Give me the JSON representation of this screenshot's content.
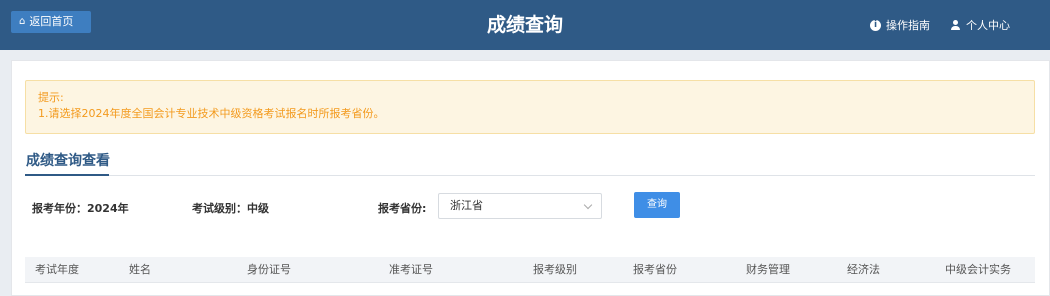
{
  "header": {
    "home_label": "返回首页",
    "title": "成绩查询",
    "guide_label": "操作指南",
    "user_label": "个人中心"
  },
  "notice": {
    "title": "提示:",
    "line1": "1.请选择2024年度全国会计专业技术中级资格考试报名时所报考省份。"
  },
  "section": {
    "title": "成绩查询查看"
  },
  "form": {
    "year_label": "报考年份：2024年",
    "level_label": "考试级别：中级",
    "province_label": "报考省份:",
    "province_value": "浙江省",
    "query_label": "查询"
  },
  "table": {
    "columns": [
      "考试年度",
      "姓名",
      "身份证号",
      "准考证号",
      "报考级别",
      "报考省份",
      "财务管理",
      "经济法",
      "中级会计实务"
    ]
  },
  "colors": {
    "header_bg": "#2f5a86",
    "button_blue": "#3f8ee6",
    "notice_text": "#f39a1d"
  }
}
